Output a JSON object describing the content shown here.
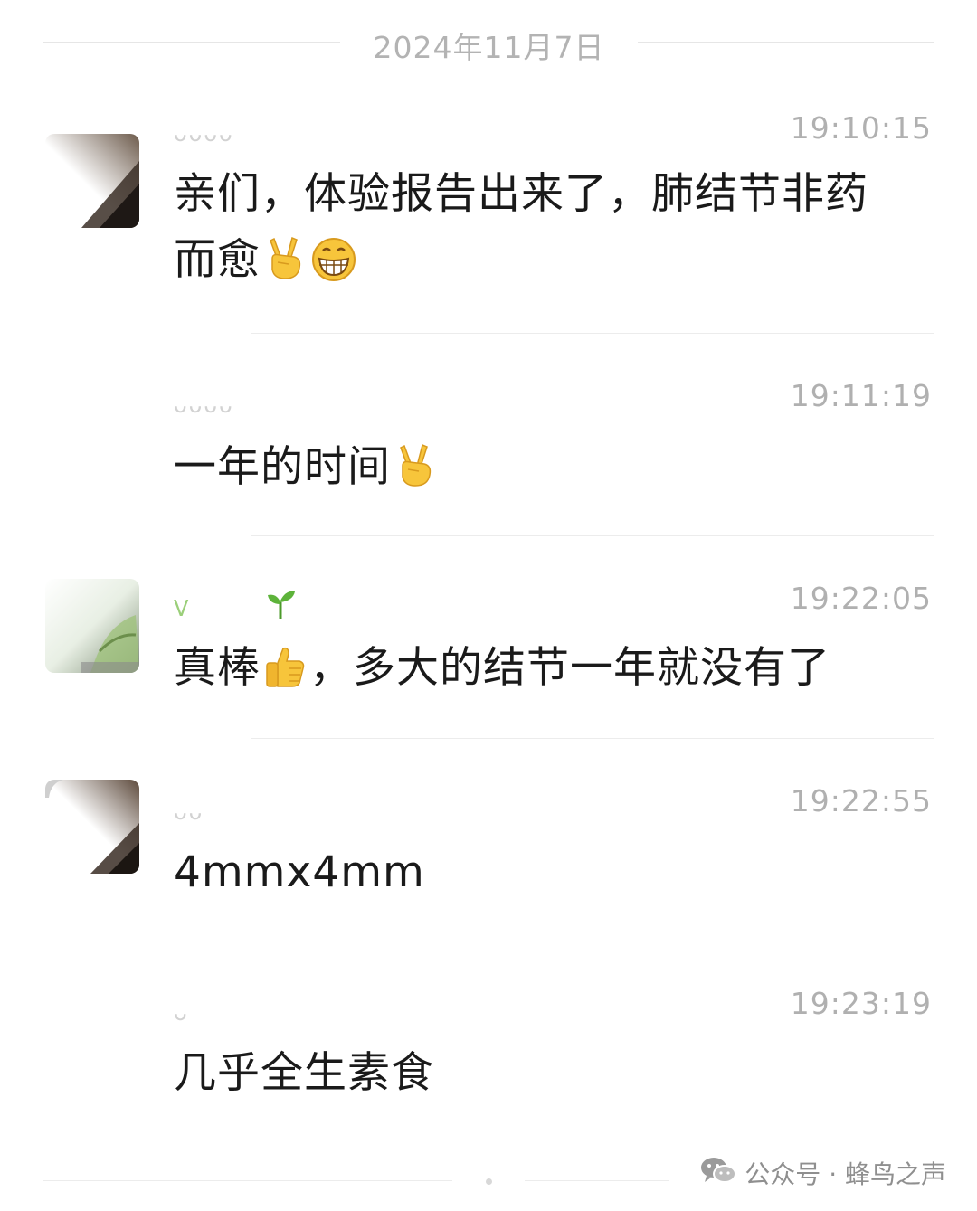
{
  "date_separator": "2024年11月7日",
  "messages": [
    {
      "sender": "ᴗᴗᴗᴗ",
      "time": "19:10:15",
      "text_line1": "亲们，体验报告出来了，肺结节非药",
      "text_line2": "而愈",
      "emojis": [
        "victory-hand-icon",
        "grinning-face-icon"
      ]
    },
    {
      "sender": "ᴗᴗᴗᴗ",
      "time": "19:11:19",
      "text": "一年的时间",
      "emojis": [
        "victory-hand-icon"
      ]
    },
    {
      "sender": "ᐯ",
      "sender_icon": "sprout-icon",
      "time": "19:22:05",
      "text_before": "真棒",
      "text_after": "，多大的结节一年就没有了",
      "emojis": [
        "thumbs-up-icon"
      ]
    },
    {
      "sender": "ᴗᴗ",
      "time": "19:22:55",
      "text": "4mmx4mm"
    },
    {
      "sender": "ᴗ",
      "time": "19:23:19",
      "text": "几乎全生素食"
    }
  ],
  "watermark": {
    "icon": "wechat-icon",
    "text": "公众号 · 蜂鸟之声"
  },
  "colors": {
    "time": "#b0b0b0",
    "text": "#1a1a1a",
    "divider": "#ececec",
    "emoji_yellow": "#f7c53b"
  }
}
